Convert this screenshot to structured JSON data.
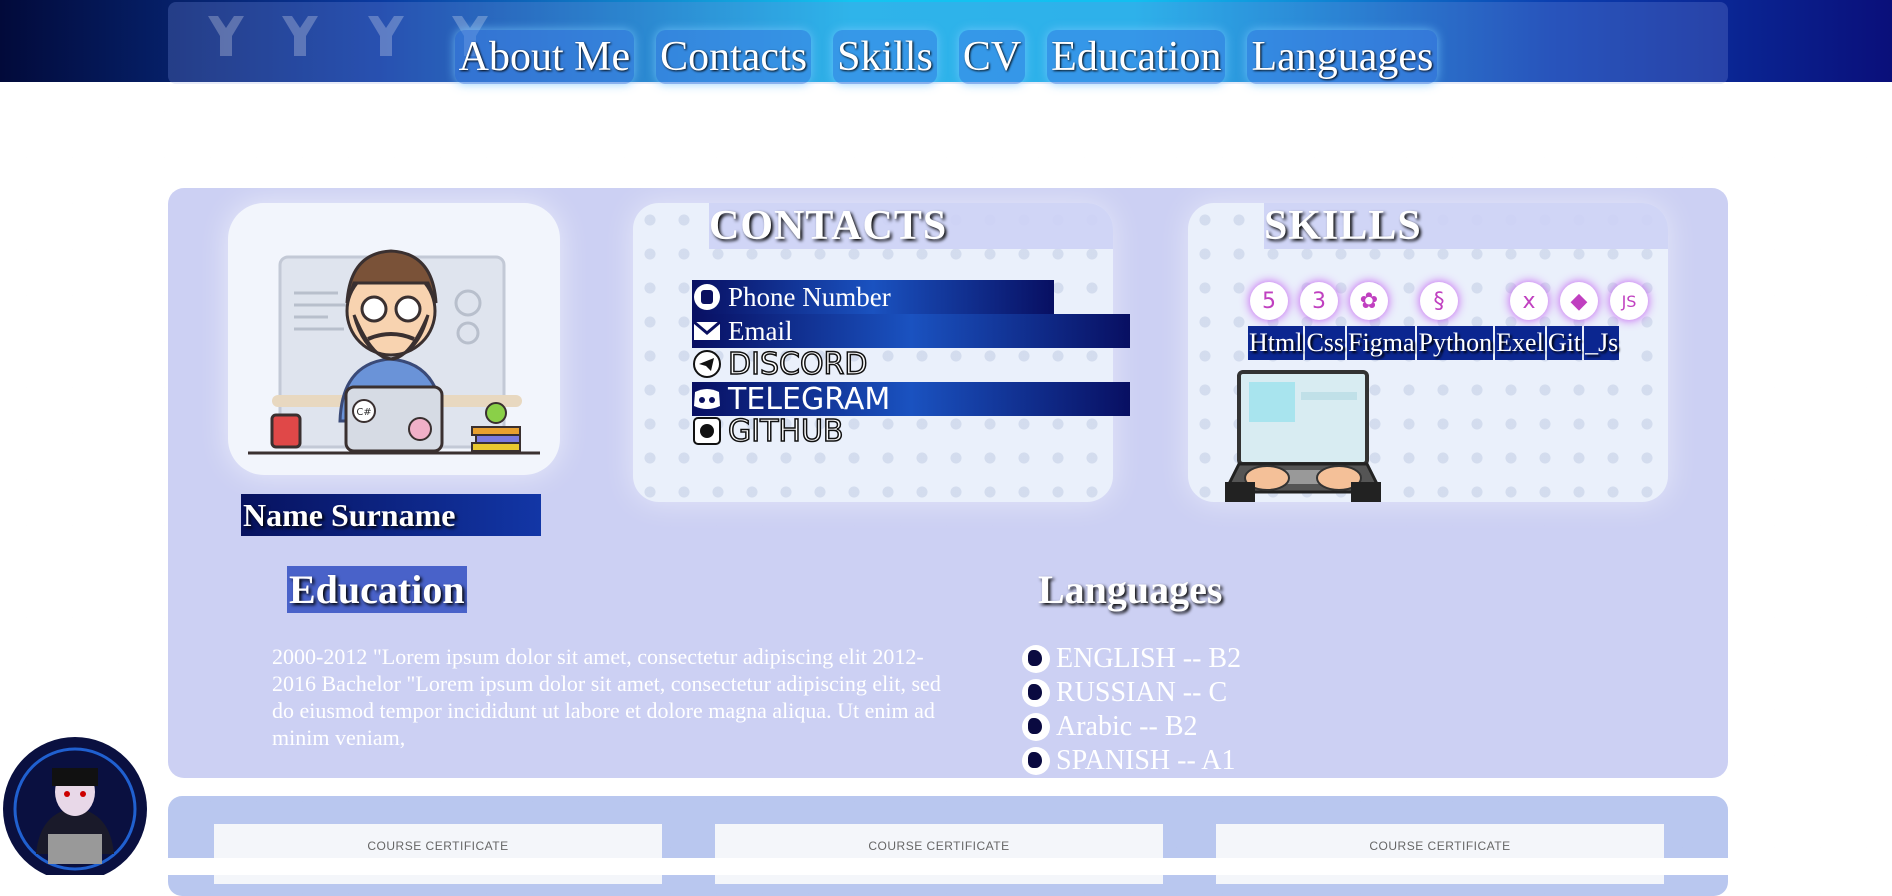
{
  "nav": {
    "links": [
      "About Me",
      "Contacts",
      "Skills",
      "CV",
      "Education",
      "Languages"
    ]
  },
  "profile": {
    "name": "Name Surname"
  },
  "contacts": {
    "title": "CONTACTS",
    "items": [
      "Phone Number",
      "Email",
      "DISCORD",
      "TELEGRAM",
      "GITHUB"
    ]
  },
  "skills": {
    "title": "SKILLS",
    "items": [
      "Html",
      "Css",
      "Figma",
      "Python",
      "Exel",
      "Git",
      "_Js"
    ],
    "icons": [
      "html5-icon",
      "css3-icon",
      "figma-icon",
      "python-icon",
      "excel-icon",
      "git-icon",
      "js-icon"
    ]
  },
  "education": {
    "title": "Education",
    "text": "2000-2012 \"Lorem ipsum dolor sit amet, consectetur adipiscing elit 2012-2016 Bachelor \"Lorem ipsum dolor sit amet, consectetur adipiscing elit, sed do eiusmod tempor incididunt ut labore et dolore magna aliqua. Ut enim ad minim veniam,"
  },
  "languages": {
    "title": "Languages",
    "items": [
      "ENGLISH -- B2",
      "RUSSIAN -- C",
      "Arabic -- B2",
      "SPANISH -- A1"
    ]
  },
  "certificates": {
    "items": [
      "COURSE CERTIFICATE",
      "COURSE CERTIFICATE",
      "COURSE CERTIFICATE"
    ]
  },
  "colors": {
    "accent": "#14c4f0",
    "dark_blue": "#07125f",
    "panel_bg": "#eaf0fb"
  }
}
